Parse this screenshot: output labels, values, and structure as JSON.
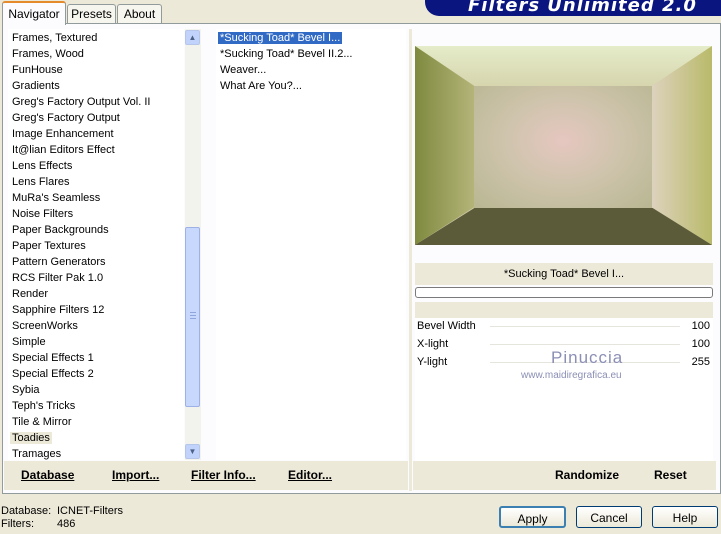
{
  "banner": {
    "title": "Filters Unlimited 2.0"
  },
  "tabs": [
    {
      "label": "Navigator"
    },
    {
      "label": "Presets"
    },
    {
      "label": "About"
    }
  ],
  "categories": [
    "Frames, Textured",
    "Frames, Wood",
    "FunHouse",
    "Gradients",
    "Greg's Factory Output Vol. II",
    "Greg's Factory Output",
    "Image Enhancement",
    "It@lian Editors Effect",
    "Lens Effects",
    "Lens Flares",
    "MuRa's Seamless",
    "Noise Filters",
    "Paper Backgrounds",
    "Paper Textures",
    "Pattern Generators",
    "RCS Filter Pak 1.0",
    "Render",
    "Sapphire Filters 12",
    "ScreenWorks",
    "Simple",
    "Special Effects 1",
    "Special Effects 2",
    "Sybia",
    "Teph's Tricks",
    "Tile & Mirror",
    "Toadies",
    "Tramages"
  ],
  "selected_category": "Toadies",
  "filters": [
    "*Sucking Toad*  Bevel I...",
    "*Sucking Toad*  Bevel II.2...",
    "Weaver...",
    "What Are You?..."
  ],
  "selected_filter": "*Sucking Toad*  Bevel I...",
  "left_buttons": {
    "database": "Database",
    "import": "Import...",
    "filter_info": "Filter Info...",
    "editor": "Editor..."
  },
  "preview": {
    "filter_name": "*Sucking Toad*  Bevel I..."
  },
  "params": [
    {
      "label": "Bevel Width",
      "value": "100"
    },
    {
      "label": "X-light",
      "value": "100"
    },
    {
      "label": "Y-light",
      "value": "255"
    }
  ],
  "watermark": {
    "name": "Pinuccia",
    "url": "www.maidiregrafica.eu"
  },
  "right_buttons": {
    "randomize": "Randomize",
    "reset": "Reset"
  },
  "status": {
    "database_label": "Database:",
    "database_value": "ICNET-Filters",
    "filters_label": "Filters:",
    "filters_value": "486"
  },
  "dialog_buttons": {
    "apply": "Apply",
    "cancel": "Cancel",
    "help": "Help"
  }
}
